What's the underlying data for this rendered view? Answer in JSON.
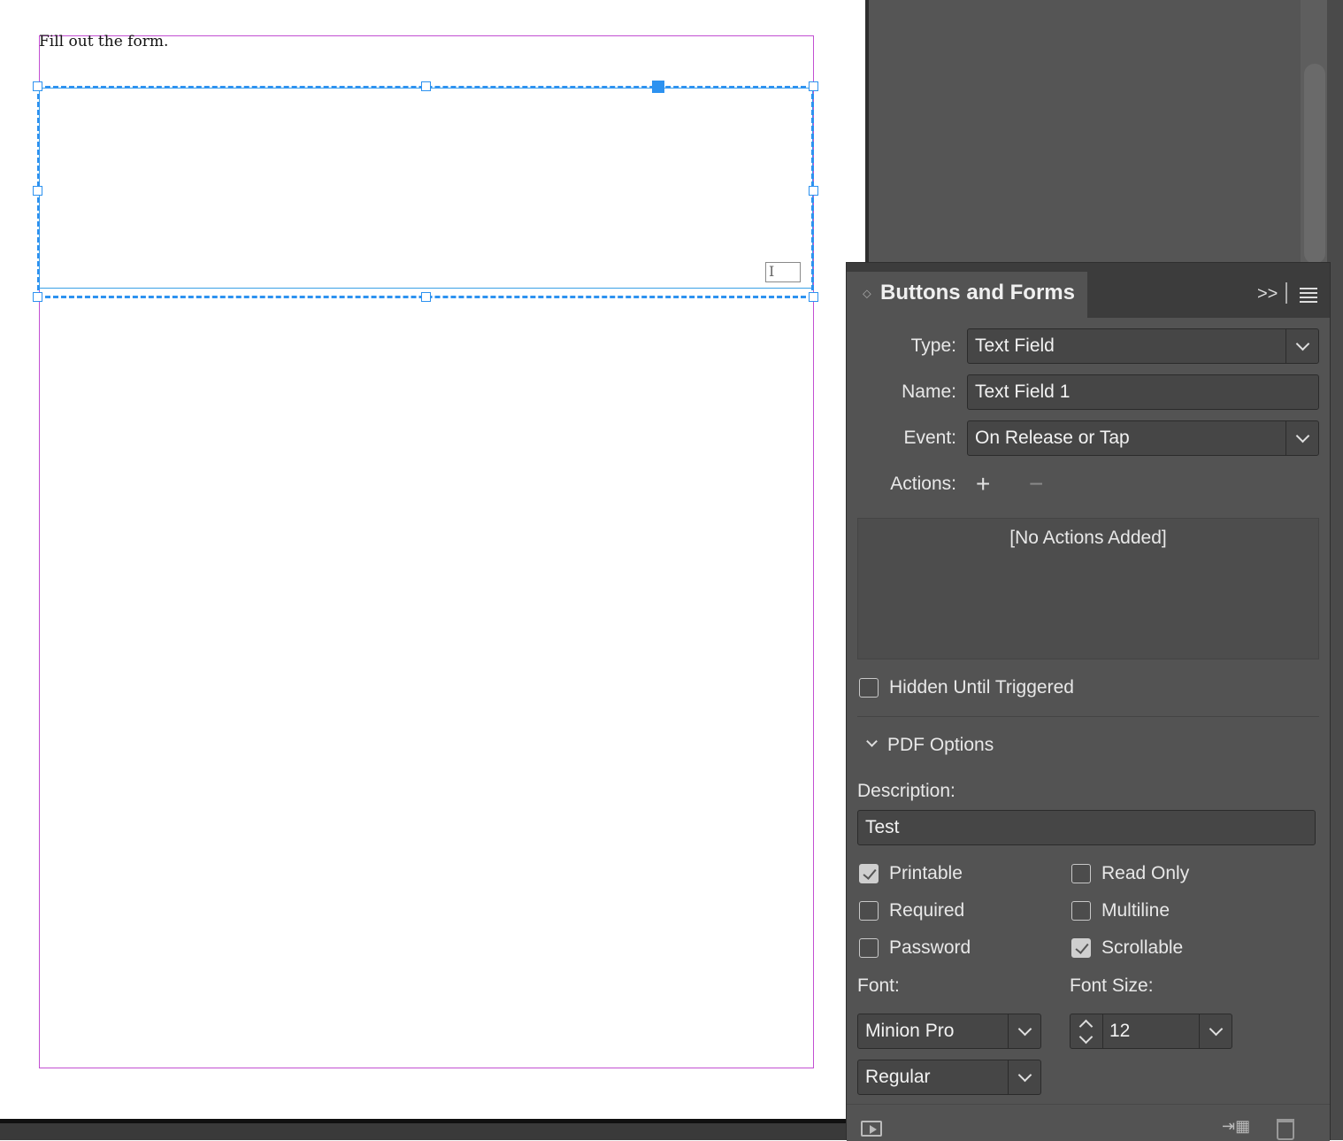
{
  "document": {
    "text": "Fill out the form."
  },
  "panel": {
    "title": "Buttons and Forms",
    "type_label": "Type:",
    "type_value": "Text Field",
    "name_label": "Name:",
    "name_value": "Text Field 1",
    "event_label": "Event:",
    "event_value": "On Release or Tap",
    "actions_label": "Actions:",
    "add_action": "+",
    "remove_action": "−",
    "no_actions": "[No Actions Added]",
    "hidden_until_triggered": "Hidden Until Triggered",
    "pdf_options": "PDF Options",
    "description_label": "Description:",
    "description_value": "Test",
    "options": {
      "printable": {
        "label": "Printable",
        "checked": true
      },
      "read_only": {
        "label": "Read Only",
        "checked": false
      },
      "required": {
        "label": "Required",
        "checked": false
      },
      "multiline": {
        "label": "Multiline",
        "checked": false
      },
      "password": {
        "label": "Password",
        "checked": false
      },
      "scrollable": {
        "label": "Scrollable",
        "checked": true
      }
    },
    "font_label": "Font:",
    "font_value": "Minion Pro",
    "font_style_value": "Regular",
    "font_size_label": "Font Size:",
    "font_size_value": "12"
  },
  "colors": {
    "selection": "#2d92f0",
    "margin_guide": "#c24fd2",
    "panel_bg": "#535353"
  }
}
